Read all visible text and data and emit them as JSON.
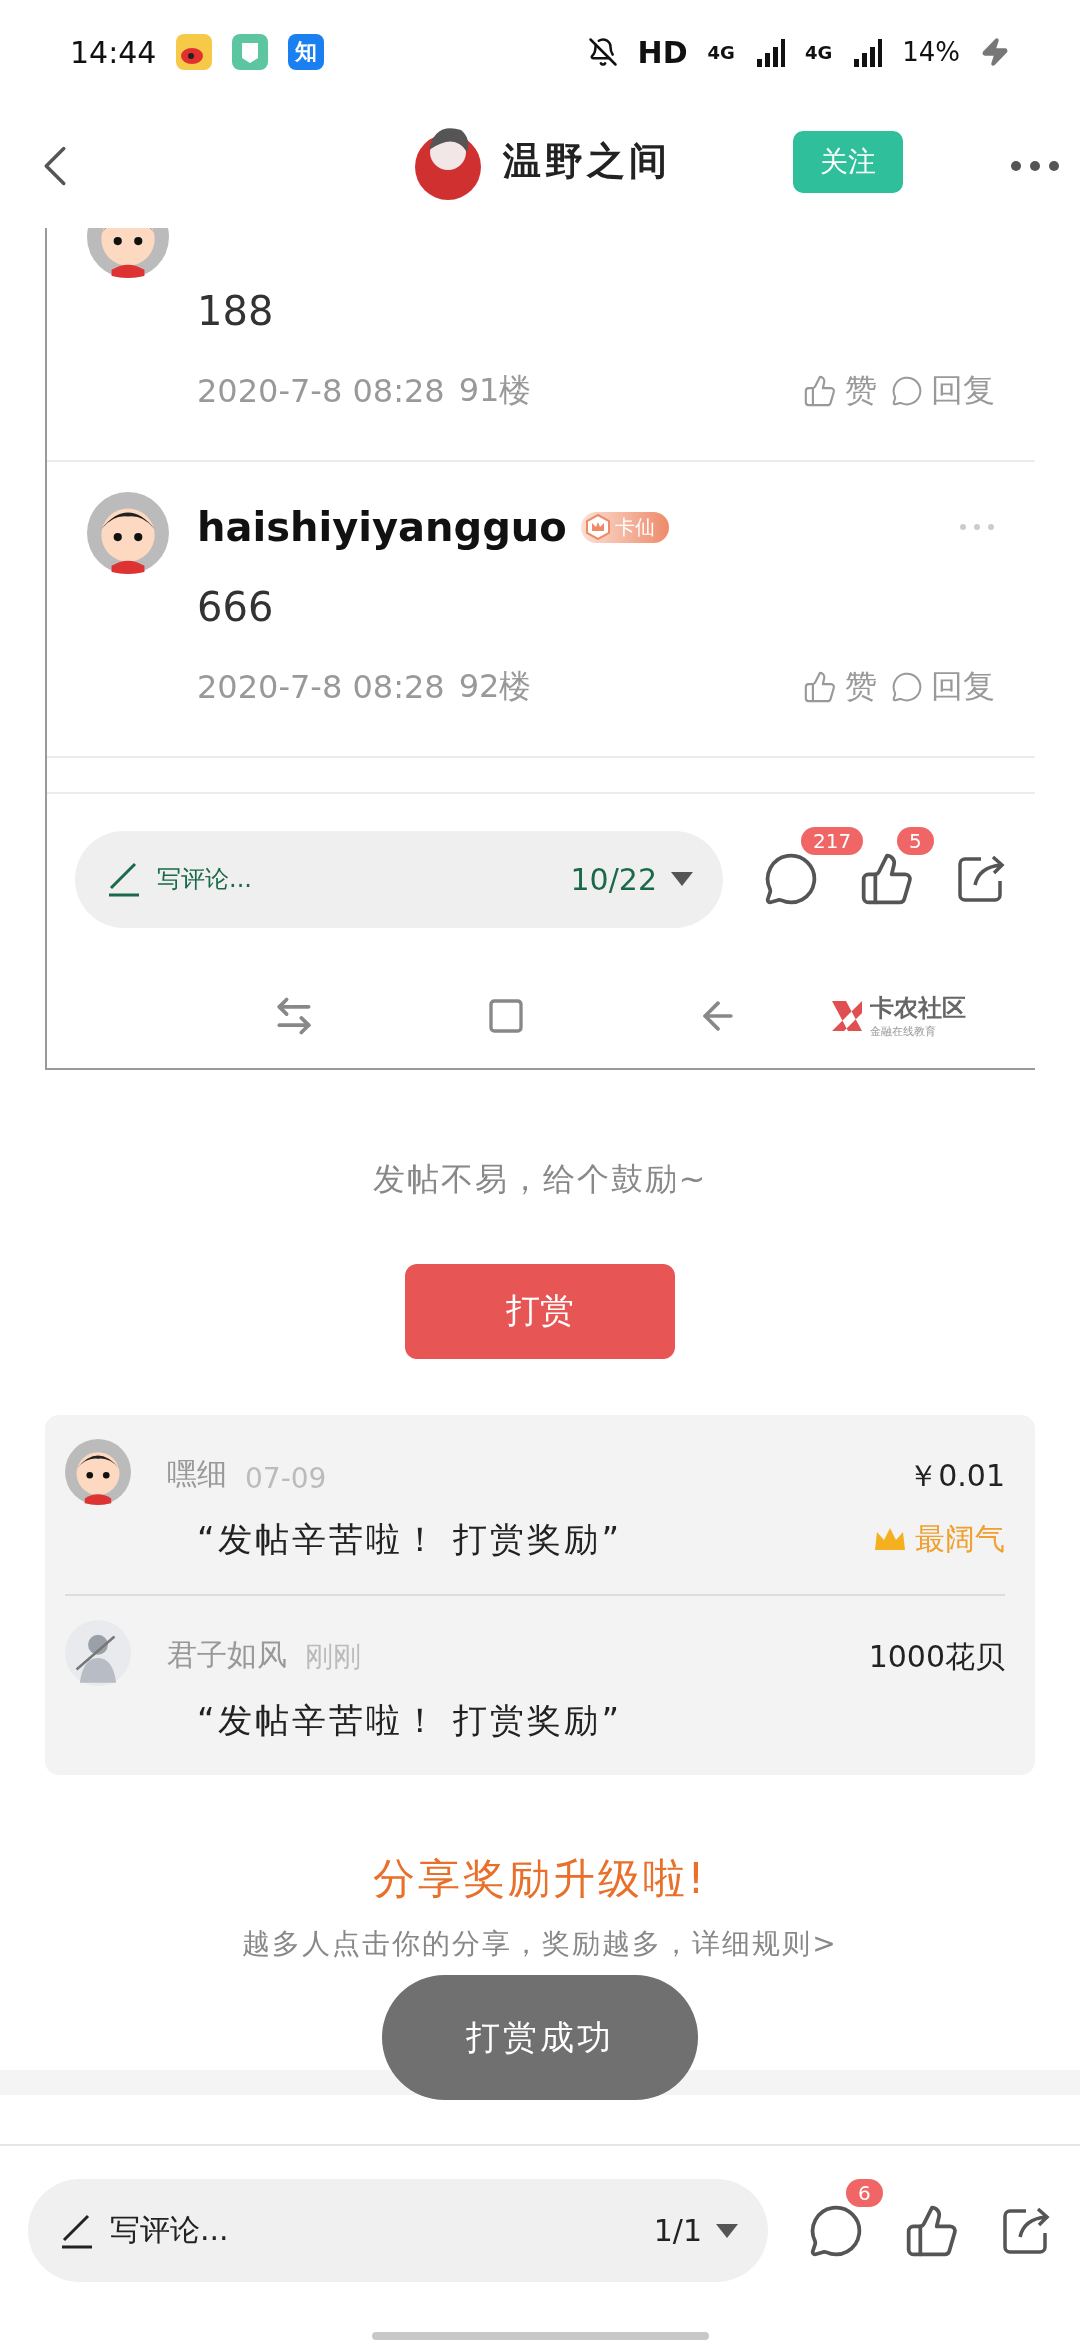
{
  "status_bar": {
    "time": "14:44",
    "app_badge": "知",
    "hd": "HD",
    "signal_1": "4G",
    "signal_2": "4G",
    "battery": "14%"
  },
  "header": {
    "title": "温野之间",
    "follow_button": "关注"
  },
  "screenshot": {
    "comments": [
      {
        "partial": true,
        "content": "188",
        "time": "2020-7-8 08:28",
        "floor": "91楼",
        "like": "赞",
        "reply": "回复"
      },
      {
        "partial": false,
        "name": "haishiyiyangguo",
        "badge": "卡仙",
        "content": "666",
        "time": "2020-7-8 08:28",
        "floor": "92楼",
        "like": "赞",
        "reply": "回复"
      }
    ],
    "comment_bar": {
      "placeholder": "写评论...",
      "page": "10/22",
      "comment_count": "217",
      "like_count": "5"
    },
    "logo": {
      "title": "卡农社区",
      "subtitle": "金融在线教育"
    }
  },
  "reward": {
    "prompt": "发帖不易，给个鼓励~",
    "button": "打赏",
    "records": [
      {
        "kind": "cartoon",
        "name": "嘿细",
        "time": "07-09",
        "amount": "￥0.01",
        "message": "“发帖辛苦啦！ 打赏奖励”",
        "top_label": "最阔气"
      },
      {
        "name": "君子如风",
        "time": "刚刚",
        "amount": "1000花贝",
        "message": "“发帖辛苦啦！ 打赏奖励”"
      }
    ]
  },
  "share": {
    "title": "分享奖励升级啦!",
    "subtitle": "越多人点击你的分享，奖励越多，详细规则>"
  },
  "toast": "打赏成功",
  "bottom_bar": {
    "placeholder": "写评论...",
    "page": "1/1",
    "comment_count": "6"
  }
}
